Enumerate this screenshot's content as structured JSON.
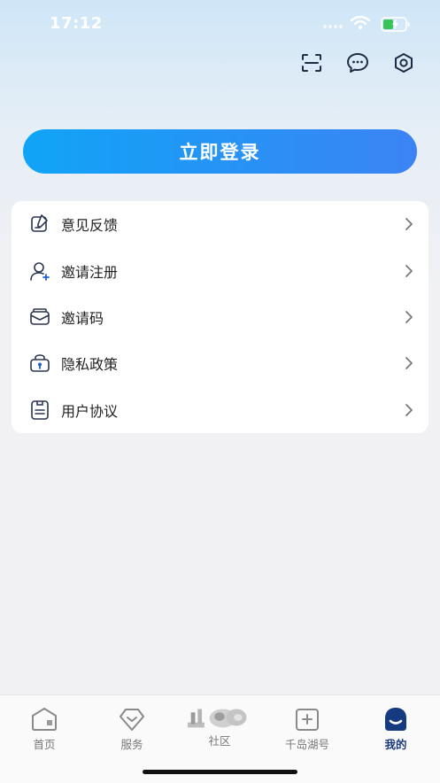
{
  "status_bar": {
    "time": "17:12",
    "battery_charging": true
  },
  "top_actions": [
    {
      "name": "scan-icon"
    },
    {
      "name": "message-icon"
    },
    {
      "name": "settings-icon"
    }
  ],
  "login": {
    "label": "立即登录"
  },
  "menu": {
    "items": [
      {
        "label": "意见反馈",
        "icon": "feedback-icon"
      },
      {
        "label": "邀请注册",
        "icon": "invite-user-icon"
      },
      {
        "label": "邀请码",
        "icon": "invite-code-icon"
      },
      {
        "label": "隐私政策",
        "icon": "privacy-lock-icon"
      },
      {
        "label": "用户协议",
        "icon": "agreement-icon"
      }
    ]
  },
  "tabbar": {
    "tabs": [
      {
        "label": "首页",
        "icon": "home-icon"
      },
      {
        "label": "服务",
        "icon": "service-icon"
      },
      {
        "label": "社区",
        "icon": "community-icon"
      },
      {
        "label": "千岛湖号",
        "icon": "qiandaohu-icon"
      },
      {
        "label": "我的",
        "icon": "profile-icon",
        "active": true
      }
    ]
  },
  "colors": {
    "accent_start": "#10a4f6",
    "accent_end": "#3b83f4",
    "active_tab": "#1a3a7c"
  }
}
